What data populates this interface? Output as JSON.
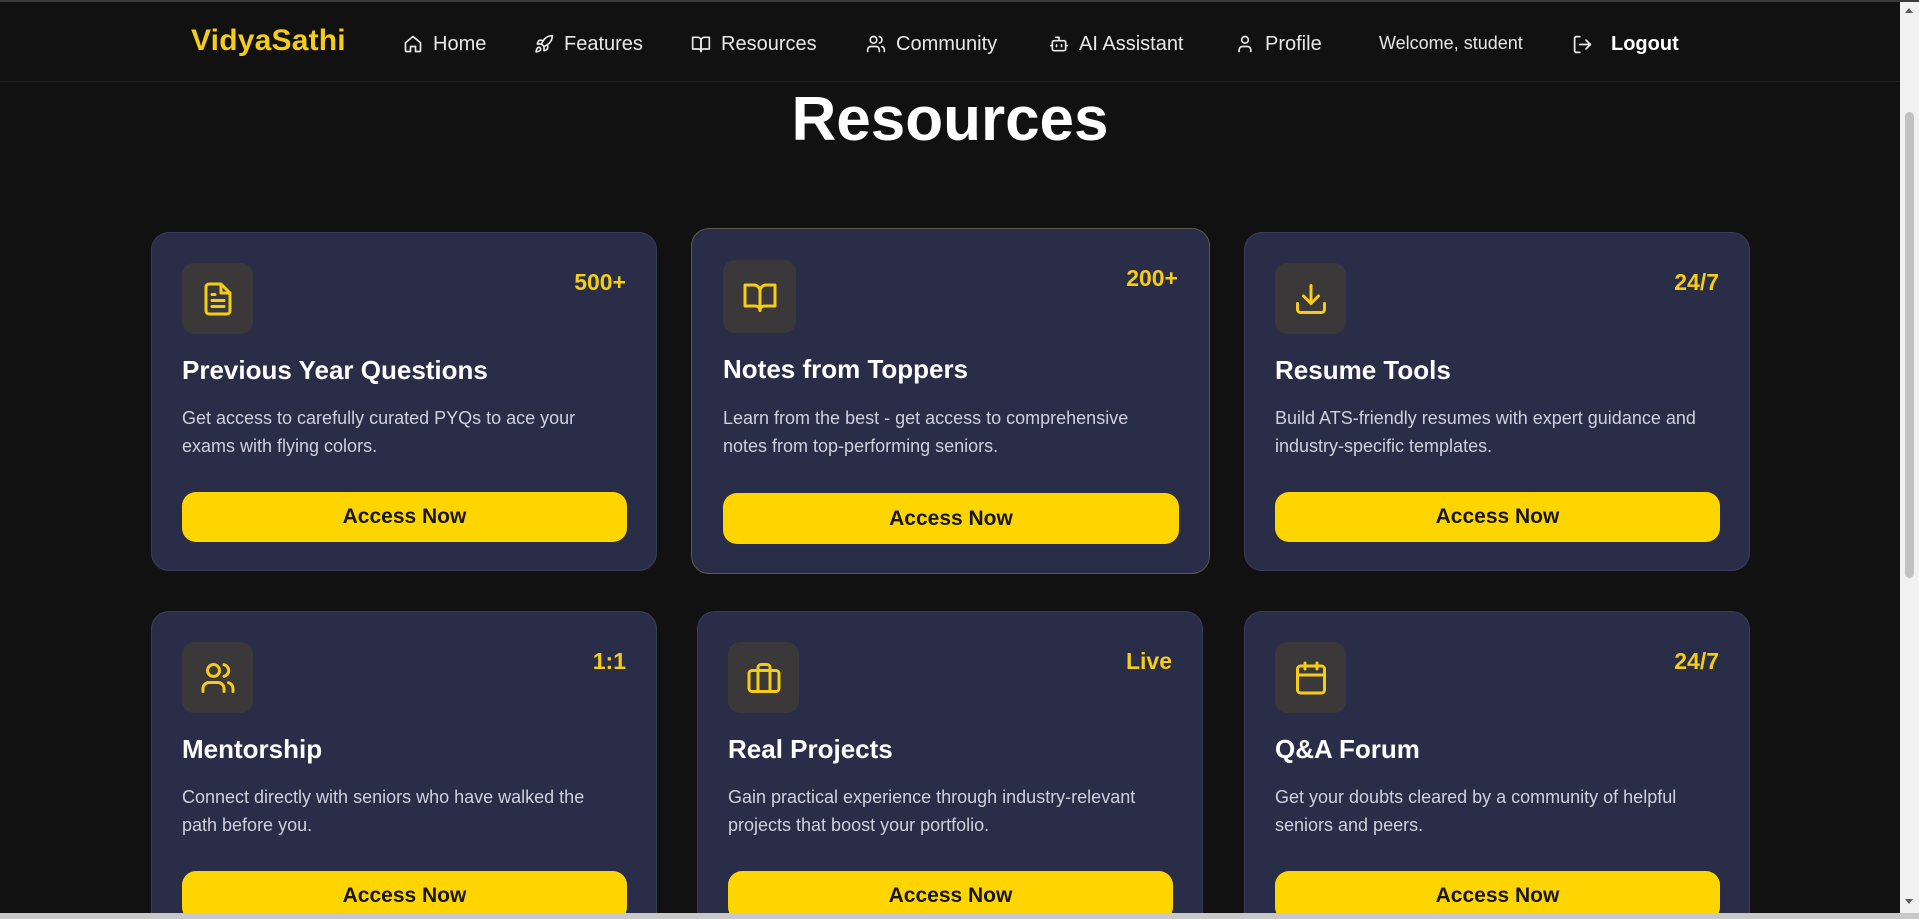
{
  "nav": {
    "brand": "VidyaSathi",
    "items": [
      {
        "label": "Home",
        "icon": "home-icon"
      },
      {
        "label": "Features",
        "icon": "rocket-icon"
      },
      {
        "label": "Resources",
        "icon": "book-open-icon"
      },
      {
        "label": "Community",
        "icon": "users-icon"
      },
      {
        "label": "AI Assistant",
        "icon": "bot-icon"
      },
      {
        "label": "Profile",
        "icon": "user-icon"
      }
    ],
    "welcome": "Welcome, student",
    "logout": "Logout",
    "logout_icon": "logout-icon"
  },
  "page": {
    "title": "Resources"
  },
  "cards": [
    {
      "title": "Previous Year Questions",
      "stat": "500+",
      "icon": "file-text-icon",
      "description": "Get access to carefully curated PYQs to ace your exams with flying colors.",
      "button": "Access Now"
    },
    {
      "title": "Notes from Toppers",
      "stat": "200+",
      "icon": "book-open-icon",
      "description": "Learn from the best - get access to comprehensive notes from top-performing seniors.",
      "button": "Access Now"
    },
    {
      "title": "Resume Tools",
      "stat": "24/7",
      "icon": "download-icon",
      "description": "Build ATS-friendly resumes with expert guidance and industry-specific templates.",
      "button": "Access Now"
    },
    {
      "title": "Mentorship",
      "stat": "1:1",
      "icon": "users-icon",
      "description": "Connect directly with seniors who have walked the path before you.",
      "button": "Access Now"
    },
    {
      "title": "Real Projects",
      "stat": "Live",
      "icon": "briefcase-icon",
      "description": "Gain practical experience through industry-relevant projects that boost your portfolio.",
      "button": "Access Now"
    },
    {
      "title": "Q&A Forum",
      "stat": "24/7",
      "icon": "calendar-icon",
      "description": "Get your doubts cleared by a community of helpful seniors and peers.",
      "button": "Access Now"
    }
  ],
  "colors": {
    "accent": "#f5cc17",
    "button": "#ffd500",
    "card_bg": "#2a2d48",
    "page_bg": "#111111"
  }
}
